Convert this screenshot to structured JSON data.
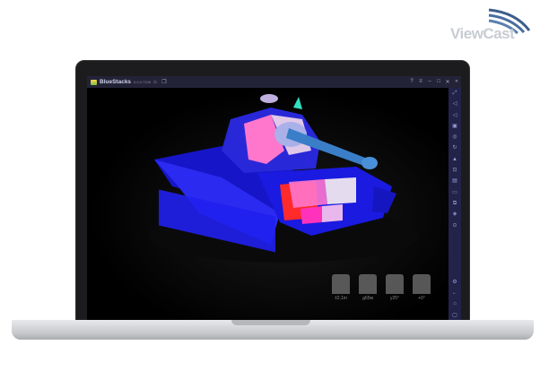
{
  "watermark": {
    "brand": "ViewCast"
  },
  "window": {
    "app_name": "BlueStacks",
    "version": "5.0.0.7228",
    "title_icons": [
      "home-icon",
      "multi-instance-icon"
    ],
    "controls": [
      "help-icon",
      "menu-icon",
      "minimize-icon",
      "maximize-icon",
      "close-icon",
      "collapse-sidebar-icon"
    ]
  },
  "sidebar": {
    "icons": [
      "fullscreen",
      "volume-up",
      "volume-down",
      "keymap",
      "camera",
      "rotate",
      "install-apk",
      "screenshot",
      "record",
      "folder",
      "multi-instance",
      "eco-mode",
      "macro",
      "settings",
      "back",
      "home",
      "recent-apps"
    ]
  },
  "hud": [
    {
      "label": "±2.1m",
      "icon": "move-icon"
    },
    {
      "label": "д65м",
      "icon": "hull-icon"
    },
    {
      "label": "у25°",
      "icon": "turret-icon"
    },
    {
      "label": "+0°",
      "icon": "gun-angle-icon"
    }
  ],
  "colors": {
    "tank": "#1a1aee",
    "armor_pink": "#ff66cc",
    "armor_white": "#e8e0f0"
  }
}
